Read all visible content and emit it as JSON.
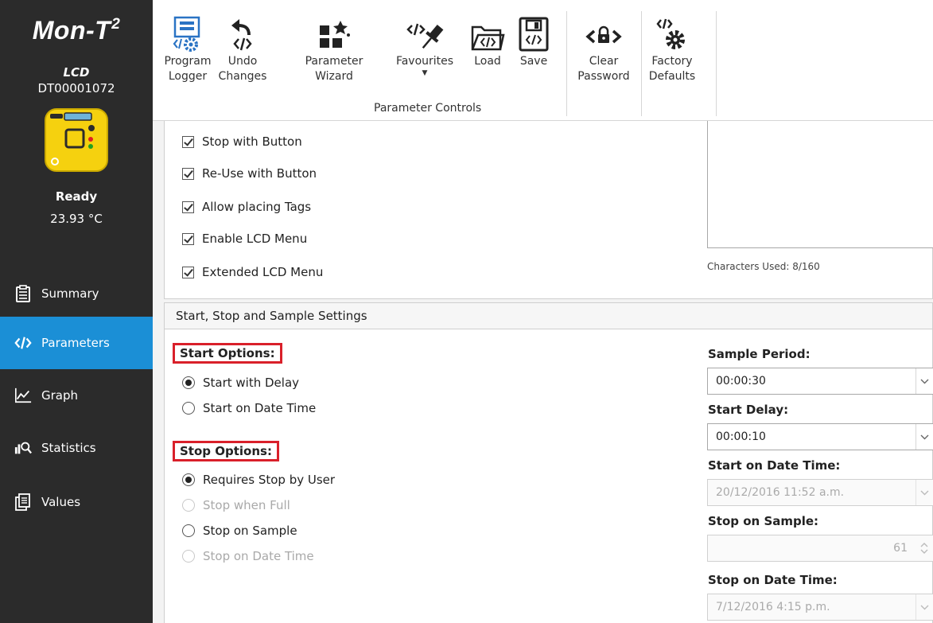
{
  "sidebar": {
    "app_title": "Mon-T",
    "app_title_sup": "2",
    "device_model": "LCD",
    "device_serial": "DT00001072",
    "device_status": "Ready",
    "device_temp": "23.93 °C",
    "nav": [
      {
        "label": "Summary",
        "icon": "clipboard-icon"
      },
      {
        "label": "Parameters",
        "icon": "code-icon",
        "active": true
      },
      {
        "label": "Graph",
        "icon": "graph-icon"
      },
      {
        "label": "Statistics",
        "icon": "statistics-icon"
      },
      {
        "label": "Values",
        "icon": "values-icon"
      }
    ]
  },
  "ribbon": {
    "buttons": [
      {
        "label": "Program\nLogger"
      },
      {
        "label": "Undo\nChanges"
      },
      {
        "label": "Parameter\nWizard"
      },
      {
        "label": "Favourites"
      },
      {
        "label": "Load"
      },
      {
        "label": "Save"
      },
      {
        "label": "Clear\nPassword"
      },
      {
        "label": "Factory\nDefaults"
      }
    ],
    "group_label": "Parameter Controls"
  },
  "options": {
    "checkboxes": [
      {
        "label": "Stop with Button",
        "checked": true
      },
      {
        "label": "Re-Use with Button",
        "checked": true
      },
      {
        "label": "Allow placing Tags",
        "checked": true
      },
      {
        "label": "Enable LCD Menu",
        "checked": true
      },
      {
        "label": "Extended LCD Menu",
        "checked": true
      }
    ],
    "characters_used": "Characters Used: 8/160"
  },
  "settings": {
    "section_title": "Start, Stop and Sample Settings",
    "start_options_label": "Start Options:",
    "start_options": [
      {
        "label": "Start with Delay",
        "checked": true,
        "enabled": true
      },
      {
        "label": "Start on Date Time",
        "checked": false,
        "enabled": true
      }
    ],
    "stop_options_label": "Stop Options:",
    "stop_options": [
      {
        "label": "Requires Stop by User",
        "checked": true,
        "enabled": true
      },
      {
        "label": "Stop when Full",
        "checked": false,
        "enabled": false
      },
      {
        "label": "Stop on Sample",
        "checked": false,
        "enabled": true
      },
      {
        "label": "Stop on Date Time",
        "checked": false,
        "enabled": false
      }
    ],
    "sample_period_label": "Sample Period:",
    "sample_period_value": "00:00:30",
    "start_delay_label": "Start Delay:",
    "start_delay_value": "00:00:10",
    "start_on_date_time_label": "Start on Date Time:",
    "start_on_date_time_value": "20/12/2016 11:52 a.m.",
    "stop_on_sample_label": "Stop on Sample:",
    "stop_on_sample_value": "61",
    "stop_on_date_time_label": "Stop on Date Time:",
    "stop_on_date_time_value": "7/12/2016 4:15 p.m."
  },
  "colors": {
    "sidebar_bg": "#2b2b2b",
    "active_nav": "#1b8fd6",
    "device_yellow": "#f5d10f",
    "icon_blue": "#2a73c4",
    "highlight_red": "#d9202a"
  }
}
